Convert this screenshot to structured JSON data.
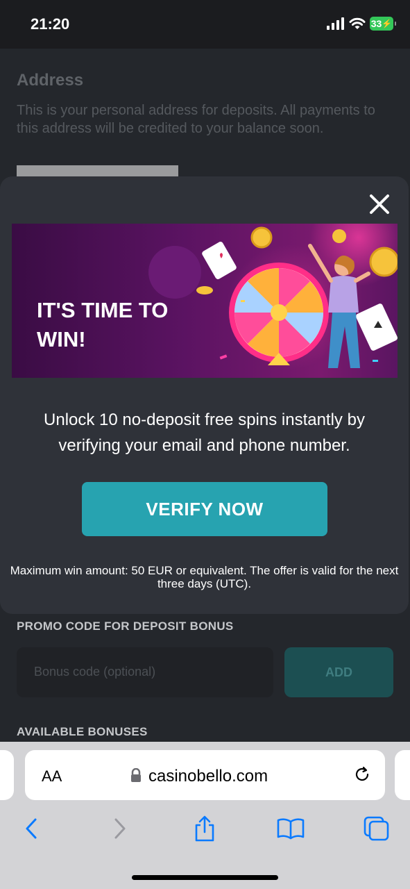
{
  "status": {
    "time": "21:20",
    "battery": "33"
  },
  "page": {
    "address_title": "Address",
    "address_description": "This is your personal address for deposits. All payments to this address will be credited to your balance soon.",
    "promo_title": "PROMO CODE FOR DEPOSIT BONUS",
    "promo_placeholder": "Bonus code (optional)",
    "add_label": "ADD",
    "available_bonuses_title": "AVAILABLE BONUSES"
  },
  "modal": {
    "banner_text": "IT'S TIME TO WIN!",
    "message": "Unlock 10 no-deposit free spins instantly by verifying your email and phone number.",
    "verify_label": "VERIFY NOW",
    "terms": "Maximum win amount: 50 EUR or equivalent. The offer is valid for the next three days (UTC)."
  },
  "browser": {
    "text_size_label": "AA",
    "url": "casinobello.com"
  },
  "colors": {
    "accent": "#27a3b0",
    "modal_bg": "#2f3239",
    "banner_purple": "#5a1561"
  }
}
